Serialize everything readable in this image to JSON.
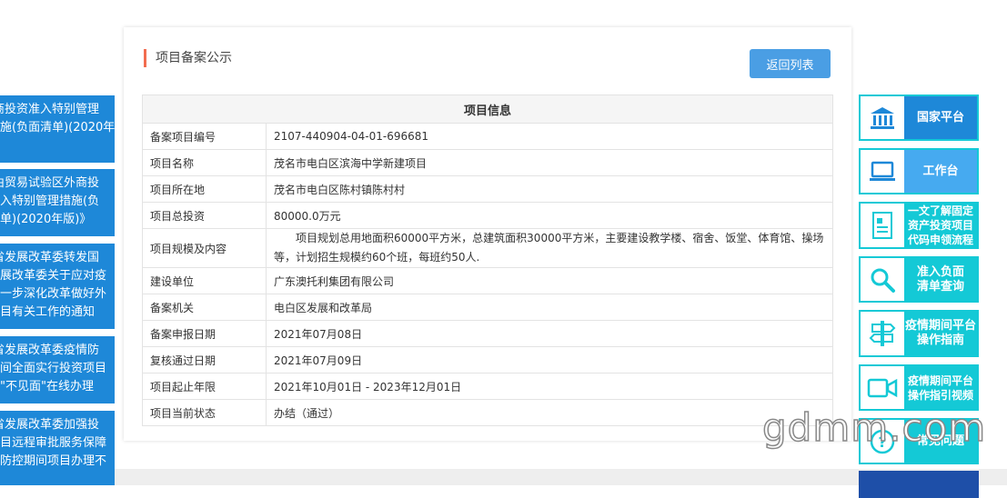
{
  "left_news": [
    {
      "text": "商投资准入特别管理\n施(负面清单)(2020年\n"
    },
    {
      "text": "由贸易试验区外商投\n入特别管理措施(负\n单)(2020年版)》"
    },
    {
      "text": "省发展改革委转发国\n展改革委关于应对疫\n一步深化改革做好外\n目有关工作的通知"
    },
    {
      "text": "省发展改革委疫情防\n间全面实行投资项目\n\"不见面\"在线办理"
    },
    {
      "text": "省发展改革委加强投\n目远程审批服务保障\n防控期间项目办理不\n"
    }
  ],
  "panel": {
    "title": "项目备案公示",
    "back_label": "返回列表"
  },
  "table": {
    "header": "项目信息",
    "rows": [
      {
        "key": "备案项目编号",
        "value": "2107-440904-04-01-696681"
      },
      {
        "key": "项目名称",
        "value": "茂名市电白区滨海中学新建项目"
      },
      {
        "key": "项目所在地",
        "value": "茂名市电白区陈村镇陈村村"
      },
      {
        "key": "项目总投资",
        "value": "80000.0万元"
      },
      {
        "key": "项目规模及内容",
        "value": "项目规划总用地面积60000平方米，总建筑面积30000平方米，主要建设教学楼、宿舍、饭堂、体育馆、操场等，计划招生规模约60个班，每班约50人."
      },
      {
        "key": "建设单位",
        "value": "广东澳托利集团有限公司"
      },
      {
        "key": "备案机关",
        "value": "电白区发展和改革局"
      },
      {
        "key": "备案申报日期",
        "value": "2021年07月08日"
      },
      {
        "key": "复核通过日期",
        "value": "2021年07月09日"
      },
      {
        "key": "项目起止年限",
        "value": "2021年10月01日 - 2023年12月01日"
      },
      {
        "key": "项目当前状态",
        "value": "办结（通过）"
      }
    ]
  },
  "right_links": [
    {
      "label": "国家平台",
      "icon": "government-building-icon",
      "color": "#1e88d8"
    },
    {
      "label": "工作台",
      "icon": "laptop-icon",
      "color": "#46aaf0"
    },
    {
      "label": "一文了解固定\n资产投资项目\n代码申领流程",
      "icon": "document-icon",
      "color": "#14c9d6"
    },
    {
      "label": "准入负面\n清单查询",
      "icon": "search-icon",
      "color": "#14c9d6"
    },
    {
      "label": "疫情期间平台\n操作指南",
      "icon": "signpost-icon",
      "color": "#14c9d6"
    },
    {
      "label": "疫情期间平台\n操作指引视频",
      "icon": "video-camera-icon",
      "color": "#14c9d6"
    },
    {
      "label": "常见问题",
      "icon": "question-icon",
      "color": "#14c9d6"
    }
  ],
  "watermark": "gdmm.com"
}
